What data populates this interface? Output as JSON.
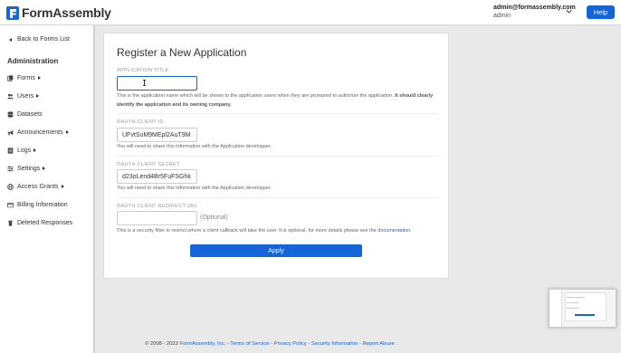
{
  "header": {
    "brand": "FormAssembly",
    "user_email": "admin@formassembly.com",
    "user_role": "admin",
    "help_label": "Help"
  },
  "sidebar": {
    "back_label": "Back to Forms List",
    "heading": "Administration",
    "items": [
      {
        "label": "Forms",
        "icon": "forms-icon",
        "has_submenu": true
      },
      {
        "label": "Users",
        "icon": "users-icon",
        "has_submenu": true
      },
      {
        "label": "Datasets",
        "icon": "database-icon",
        "has_submenu": false
      },
      {
        "label": "Announcements",
        "icon": "megaphone-icon",
        "has_submenu": true
      },
      {
        "label": "Logs",
        "icon": "logs-icon",
        "has_submenu": true
      },
      {
        "label": "Settings",
        "icon": "sliders-icon",
        "has_submenu": true
      },
      {
        "label": "Access Grants",
        "icon": "globe-icon",
        "has_submenu": true
      },
      {
        "label": "Billing Information",
        "icon": "credit-card-icon",
        "has_submenu": false
      },
      {
        "label": "Deleted Responses",
        "icon": "trash-icon",
        "has_submenu": false
      }
    ]
  },
  "main": {
    "title": "Register a New Application",
    "app_title": {
      "label": "APPLICATION TITLE",
      "value": "",
      "help": "This is the application name which will be shown to the application users when they are prompted to authorize the application.",
      "help_bold": "It should clearly identify the application and its owning company."
    },
    "client_id": {
      "label": "OAUTH CLIENT ID",
      "value": "UFvtSuM9MEpl2AuT9M",
      "help": "You will need to share this information with the Application developper."
    },
    "client_secret": {
      "label": "OAUTH CLIENT SECRET",
      "value": "d23oLend4Br5FuFSGhk",
      "help": "You will need to share this information with the Application developper."
    },
    "redirect_uri": {
      "label": "OAUTH CLIENT REDIRECT URI",
      "value": "",
      "optional": "(Optional)",
      "help": "This is a security filter to restrict where a client callback will take the user. It is optional, for more details please see the",
      "help_link": "documentation",
      "help_end": "."
    },
    "apply_label": "Apply"
  },
  "footer": {
    "copyright": "© 2008 - 2023",
    "company": "FormAssembly, Inc.",
    "links": [
      "Terms of Service",
      "Privacy Policy",
      "Security Information",
      "Report Abuse"
    ],
    "sep": " - "
  },
  "colors": {
    "accent": "#1565d8",
    "background": "#e9e9e9"
  }
}
